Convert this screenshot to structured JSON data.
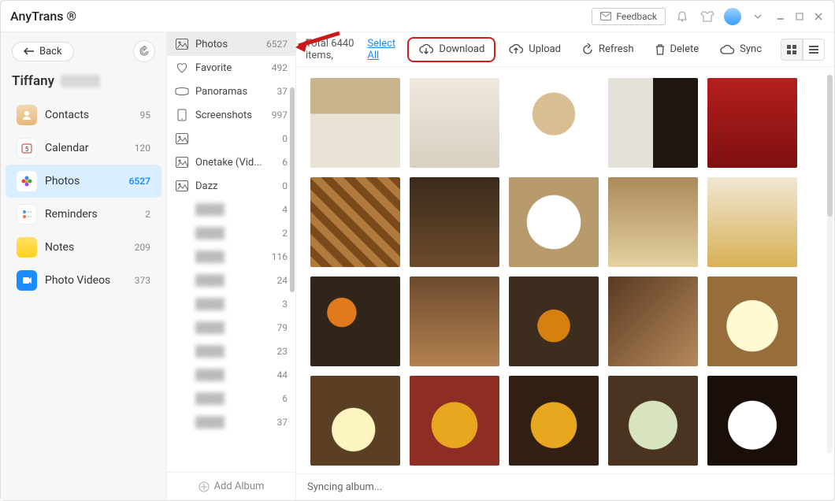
{
  "titlebar": {
    "app_name": "AnyTrans ®",
    "feedback_label": "Feedback"
  },
  "sidebar1": {
    "back_label": "Back",
    "username": "Tiffany",
    "categories": [
      {
        "icon": "contacts",
        "label": "Contacts",
        "count": "95",
        "active": false
      },
      {
        "icon": "calendar",
        "label": "Calendar",
        "count": "120",
        "active": false
      },
      {
        "icon": "photos",
        "label": "Photos",
        "count": "6527",
        "active": true
      },
      {
        "icon": "reminders",
        "label": "Reminders",
        "count": "2",
        "active": false
      },
      {
        "icon": "notes",
        "label": "Notes",
        "count": "209",
        "active": false
      },
      {
        "icon": "photovideos",
        "label": "Photo Videos",
        "count": "373",
        "active": false
      }
    ]
  },
  "albums": {
    "items": [
      {
        "name": "Photos",
        "count": "6527",
        "active": true,
        "icon": "image"
      },
      {
        "name": "Favorite",
        "count": "492",
        "active": false,
        "icon": "heart"
      },
      {
        "name": "Panoramas",
        "count": "37",
        "active": false,
        "icon": "pano"
      },
      {
        "name": "Screenshots",
        "count": "997",
        "active": false,
        "icon": "screen"
      },
      {
        "name": "",
        "count": "0",
        "active": false,
        "icon": "image"
      },
      {
        "name": "Onetake (Vid...",
        "count": "6",
        "active": false,
        "icon": "image"
      },
      {
        "name": "Dazz",
        "count": "0",
        "active": false,
        "icon": "image"
      },
      {
        "name": "blurred",
        "count": "4",
        "blurred": true
      },
      {
        "name": "blurred",
        "count": "2",
        "blurred": true
      },
      {
        "name": "blurred",
        "count": "116",
        "blurred": true
      },
      {
        "name": "blurred",
        "count": "24",
        "blurred": true
      },
      {
        "name": "blurred",
        "count": "3",
        "blurred": true
      },
      {
        "name": "blurred",
        "count": "79",
        "blurred": true
      },
      {
        "name": "blurred",
        "count": "23",
        "blurred": true
      },
      {
        "name": "blurred",
        "count": "44",
        "blurred": true
      },
      {
        "name": "blurred",
        "count": "6",
        "blurred": true
      },
      {
        "name": "blurred",
        "count": "37",
        "blurred": true
      }
    ],
    "add_label": "Add Album"
  },
  "toolbar": {
    "total_prefix": "Total ",
    "total_count": "6440",
    "total_suffix": " items, ",
    "select_all": "Select All",
    "download": "Download",
    "upload": "Upload",
    "refresh": "Refresh",
    "delete": "Delete",
    "sync": "Sync"
  },
  "status": {
    "text": "Syncing album..."
  }
}
